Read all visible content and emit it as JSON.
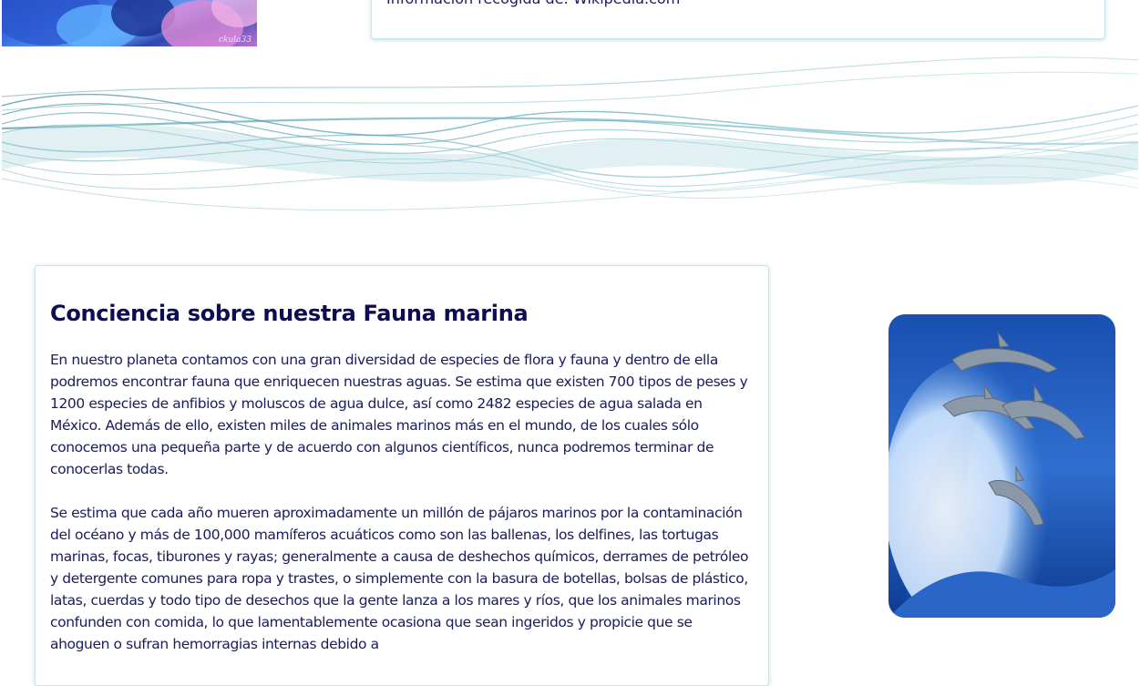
{
  "header": {
    "top_image_signature": "ckula33",
    "info_text": "Información recogida de: Wikipedia.com"
  },
  "content": {
    "title": "Conciencia sobre nuestra Fauna marina",
    "paragraphs": [
      "En nuestro planeta contamos con una gran diversidad de especies de flora y fauna y dentro de ella podremos encontrar fauna que enriquecen nuestras aguas. Se estima que existen 700 tipos de peses y 1200 especies de anfibios y moluscos de agua dulce, así como 2482 especies de agua salada en México. Además de ello, existen miles de animales marinos más en el mundo, de los cuales sólo conocemos una pequeña parte y de acuerdo con algunos científicos, nunca podremos terminar de conocerlas todas.",
      "Se estima que cada año mueren aproximadamente un millón de pájaros marinos por la contaminación del océano y más de 100,000 mamíferos acuáticos como son las ballenas, los delfines, las tortugas marinas, focas, tiburones y rayas; generalmente a causa de deshechos químicos, derrames de petróleo y detergente comunes para ropa y trastes, o simplemente con la basura de botellas, bolsas de plástico, latas, cuerdas y todo tipo de desechos que la gente lanza a los mares y ríos, que los animales marinos confunden con comida, lo que lamentablemente ocasiona que sean ingeridos y propicie que se ahoguen o sufran hemorragias internas debido a"
    ]
  },
  "colors": {
    "heading": "#0d0d55",
    "text": "#1b1b5e",
    "card_border": "#c8e6ee",
    "wave": "#5aa6b4"
  },
  "images": {
    "top_left": "blue-floral-artwork",
    "banner": "teal-wave-banner",
    "side": "dolphins-jumping-over-wave"
  }
}
